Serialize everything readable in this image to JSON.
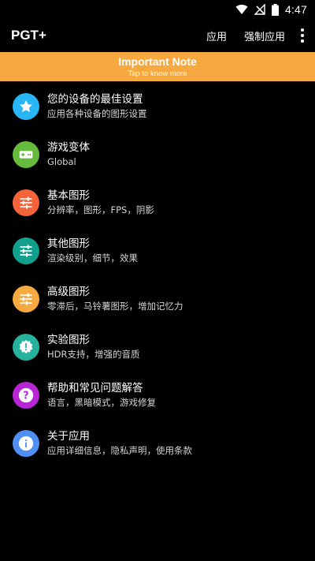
{
  "status_bar": {
    "time": "4:47",
    "icons": [
      "wifi-icon",
      "cellular-no-signal-icon",
      "battery-icon"
    ]
  },
  "app_bar": {
    "title": "PGT+",
    "actions": [
      "应用",
      "强制应用"
    ],
    "overflow_icon": "more-vertical-icon"
  },
  "banner": {
    "title": "Important Note",
    "subtitle": "Tap to know more",
    "color": "#f6a940"
  },
  "list": {
    "items": [
      {
        "title": "您的设备的最佳设置",
        "subtitle": "应用各种设备的图形设置",
        "icon": "star-icon",
        "color": "#29b6f6"
      },
      {
        "title": "游戏变体",
        "subtitle": "Global",
        "icon": "gamepad-icon",
        "color": "#66bb3c"
      },
      {
        "title": "基本图形",
        "subtitle": "分辨率，图形，FPS，阴影",
        "icon": "tune-icon",
        "color": "#f4633a"
      },
      {
        "title": "其他图形",
        "subtitle": "渲染级别，细节，效果",
        "icon": "tune-icon",
        "color": "#12a08e"
      },
      {
        "title": "高级图形",
        "subtitle": "零滞后，马铃薯图形，增加记忆力",
        "icon": "tune-icon",
        "color": "#f6a940"
      },
      {
        "title": "实验图形",
        "subtitle": "HDR支持，增强的音质",
        "icon": "alert-badge-icon",
        "color": "#25b39e"
      },
      {
        "title": "帮助和常见问题解答",
        "subtitle": "语言，黑暗模式，游戏修复",
        "icon": "help-icon",
        "color": "#b626d4"
      },
      {
        "title": "关于应用",
        "subtitle": "应用详细信息，隐私声明，使用条款",
        "icon": "info-icon",
        "color": "#4f8ff2"
      }
    ]
  }
}
